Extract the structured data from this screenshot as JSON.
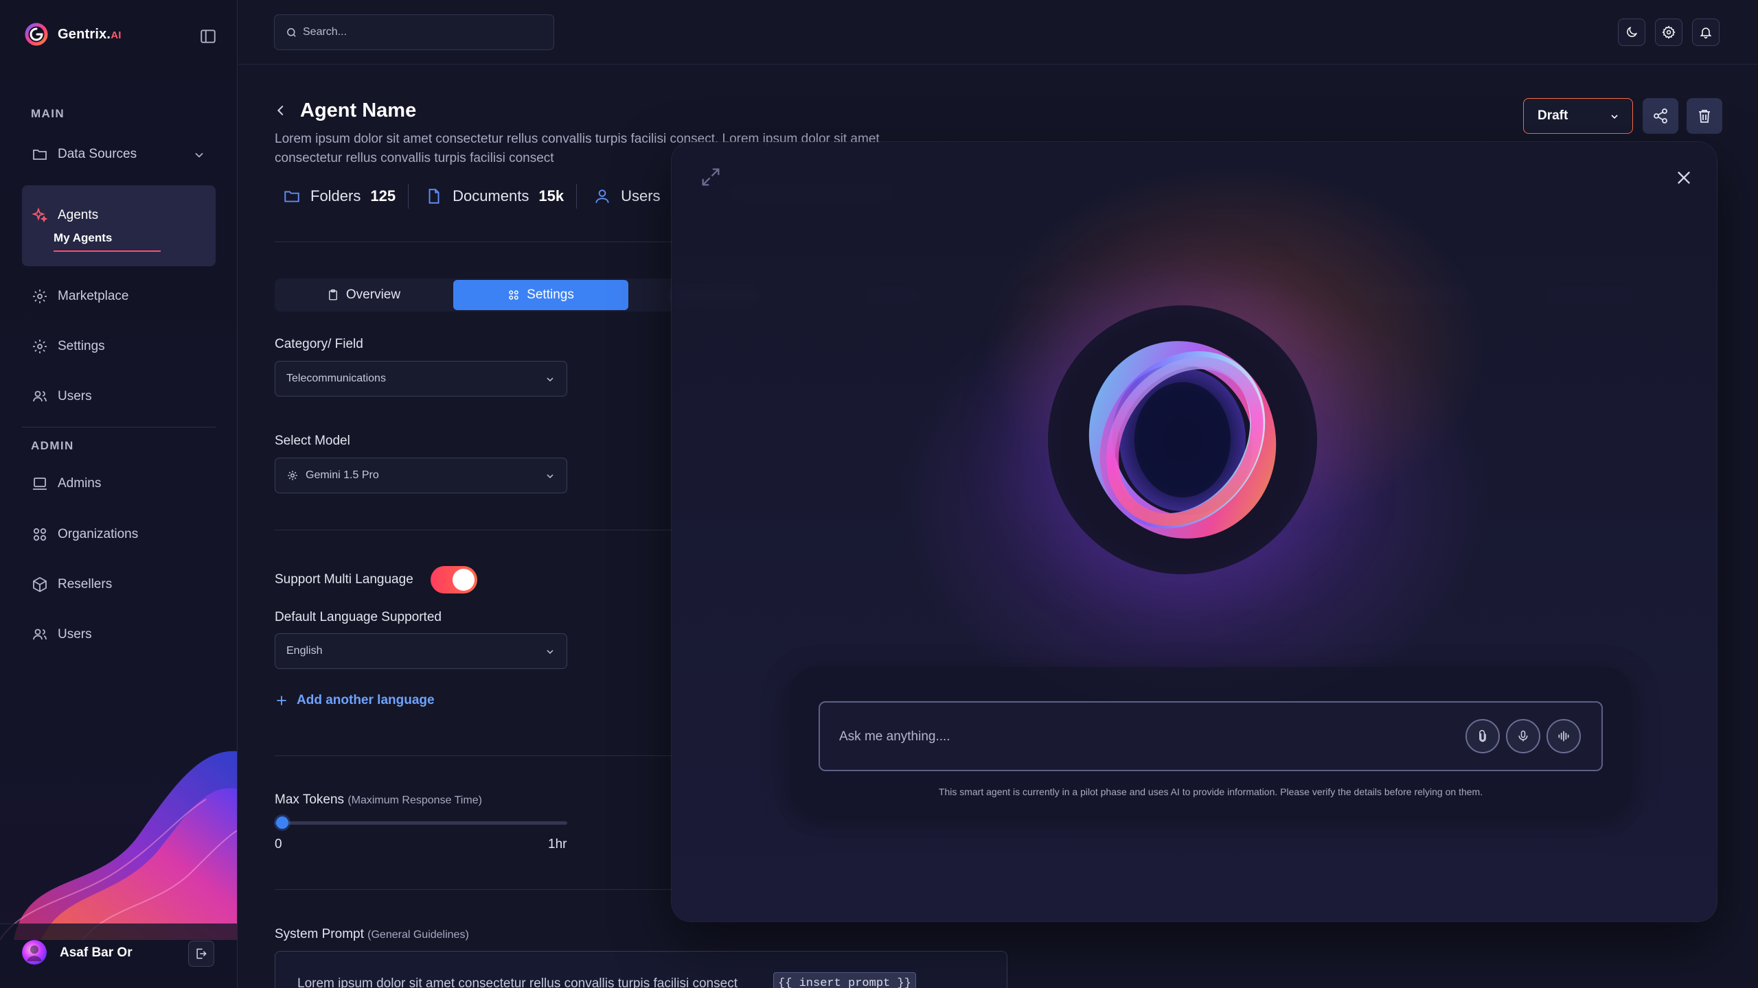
{
  "app": {
    "logo_text": "Gentrix.",
    "logo_suffix": "AI"
  },
  "sidebar": {
    "main_label": "MAIN",
    "admin_label": "ADMIN",
    "items": {
      "data_sources": "Data Sources",
      "agents": "Agents",
      "my_agents": "My Agents",
      "marketplace": "Marketplace",
      "settings": "Settings",
      "users": "Users",
      "admins": "Admins",
      "organizations": "Organizations",
      "resellers": "Resellers",
      "admin_users": "Users"
    },
    "user": {
      "name": "Asaf Bar Or"
    }
  },
  "topbar": {
    "search_placeholder": "Search..."
  },
  "agent": {
    "title": "Agent Name",
    "description": "Lorem ipsum dolor sit amet consectetur rellus convallis turpis facilisi consect. Lorem ipsum dolor sit amet consectetur rellus convallis turpis facilisi consect",
    "status": "Draft",
    "stats": [
      {
        "label": "Folders",
        "value": "125"
      },
      {
        "label": "Documents",
        "value": "15k"
      },
      {
        "label": "Users",
        "value": ""
      }
    ]
  },
  "tabs": {
    "overview": "Overview",
    "settings": "Settings"
  },
  "form": {
    "category_label": "Category/ Field",
    "category_value": "Telecommunications",
    "model_label": "Select Model",
    "model_value": "Gemini 1.5 Pro",
    "multi_language_label": "Support Multi Language",
    "multi_language_enabled": true,
    "default_language_label": "Default Language Supported",
    "default_language_value": "English",
    "add_language": "Add another language",
    "max_tokens_label": "Max Tokens",
    "max_tokens_sub": "(Maximum Response Time)",
    "max_tokens_min": "0",
    "max_tokens_max": "1hr",
    "max_tokens_value_fraction": 0,
    "system_prompt_label": "System Prompt",
    "system_prompt_sub": "(General Guidelines)",
    "system_prompt_text": "Lorem ipsum dolor sit amet consectetur rellus convallis turpis facilisi consect",
    "system_prompt_chip": "{{ insert prompt }}"
  },
  "chat": {
    "placeholder": "Ask me anything....",
    "disclaimer": "This smart agent is currently in a pilot phase and uses AI to provide information. Please verify the details before relying on them."
  },
  "colors": {
    "accent_blue": "#3d82f5",
    "accent_red": "#ff4b6e",
    "background": "#141527"
  }
}
